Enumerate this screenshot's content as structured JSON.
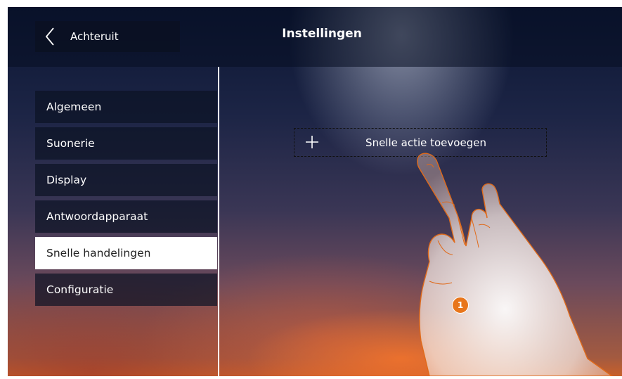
{
  "header": {
    "back_label": "Achteruit",
    "title": "Instellingen"
  },
  "menu": {
    "items": [
      {
        "label": "Algemeen"
      },
      {
        "label": "Suonerie"
      },
      {
        "label": "Display"
      },
      {
        "label": "Antwoordapparaat"
      },
      {
        "label": "Snelle handelingen",
        "active": true
      },
      {
        "label": "Configuratie"
      }
    ]
  },
  "main": {
    "add_action_label": "Snelle actie toevoegen"
  },
  "callout": {
    "number": "1"
  },
  "colors": {
    "accent": "#e8761c",
    "active_item_bg": "#ffffff",
    "text": "#ffffff"
  },
  "icons": {
    "back": "chevron-left-icon",
    "add": "plus-icon",
    "gesture": "tap-hand-icon"
  }
}
